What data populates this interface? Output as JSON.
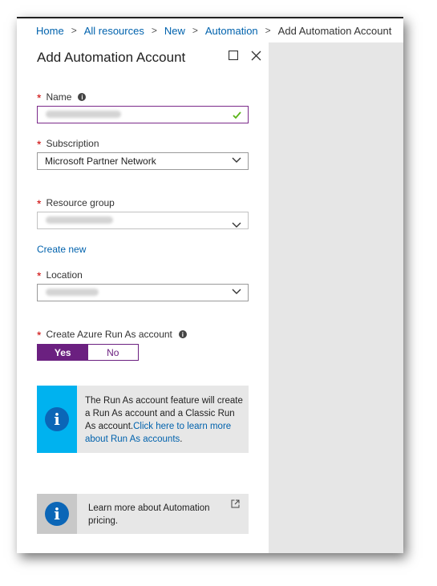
{
  "breadcrumb": {
    "items": [
      "Home",
      "All resources",
      "New",
      "Automation"
    ],
    "current": "Add Automation Account",
    "separator": ">"
  },
  "blade": {
    "title": "Add Automation Account",
    "controls": [
      "maximize-icon",
      "close-icon"
    ]
  },
  "form": {
    "name": {
      "label": "Name",
      "required": true,
      "has_info": true,
      "value_blurred": true,
      "valid": true
    },
    "subscription": {
      "label": "Subscription",
      "required": true,
      "value": "Microsoft Partner Network"
    },
    "resource_group": {
      "label": "Resource group",
      "required": true,
      "value_blurred": true,
      "create_new_label": "Create new"
    },
    "location": {
      "label": "Location",
      "required": true,
      "value_blurred": true
    },
    "run_as": {
      "label": "Create Azure Run As account",
      "required": true,
      "has_info": true,
      "options": [
        "Yes",
        "No"
      ],
      "selected": "Yes"
    }
  },
  "info_runas": {
    "text": "The Run As account feature will create a Run As account and a Classic Run As account.",
    "link_text": "Click here to learn more about Run As accounts",
    "suffix": "."
  },
  "info_pricing": {
    "text": "Learn more about Automation pricing.",
    "external_icon": "external-link-icon"
  },
  "colors": {
    "accent_purple": "#6b2080",
    "link_blue": "#0062ad",
    "info_blue_bar": "#00b2ef",
    "info_icon_blue": "#0b66b7",
    "valid_green": "#5bb419",
    "required_red": "#cc0000",
    "side_gray": "#e6e6e6"
  }
}
